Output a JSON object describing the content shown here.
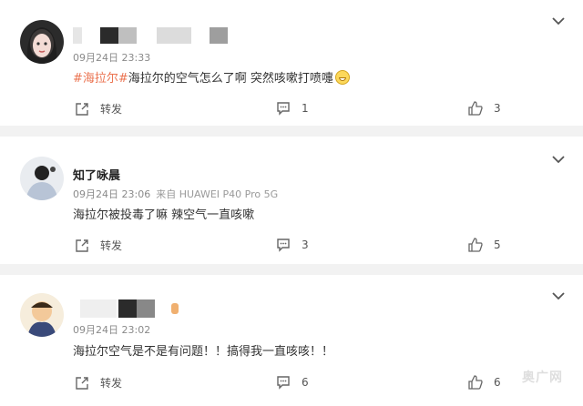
{
  "comments": [
    {
      "username_partial": "",
      "time": "09月24日 23:33",
      "source": "",
      "hashtag": "#海拉尔#",
      "text": "海拉尔的空气怎么了啊 突然咳嗽打喷嚏",
      "repost_label": "转发",
      "comment_count": "1",
      "like_count": "3"
    },
    {
      "username_partial": "知了咏晨",
      "time": "09月24日 23:06",
      "source": "来自 HUAWEI P40 Pro 5G",
      "hashtag": "",
      "text": "海拉尔被投毒了嘛 辣空气一直咳嗽",
      "repost_label": "转发",
      "comment_count": "3",
      "like_count": "5"
    },
    {
      "username_partial": "",
      "time": "09月24日 23:02",
      "source": "",
      "hashtag": "",
      "text": "海拉尔空气是不是有问题！！搞得我一直咳咳！！",
      "repost_label": "转发",
      "comment_count": "6",
      "like_count": "6"
    }
  ],
  "watermark": "奥广网",
  "colors": {
    "hashtag": "#eb7350",
    "background": "#f2f2f2"
  }
}
